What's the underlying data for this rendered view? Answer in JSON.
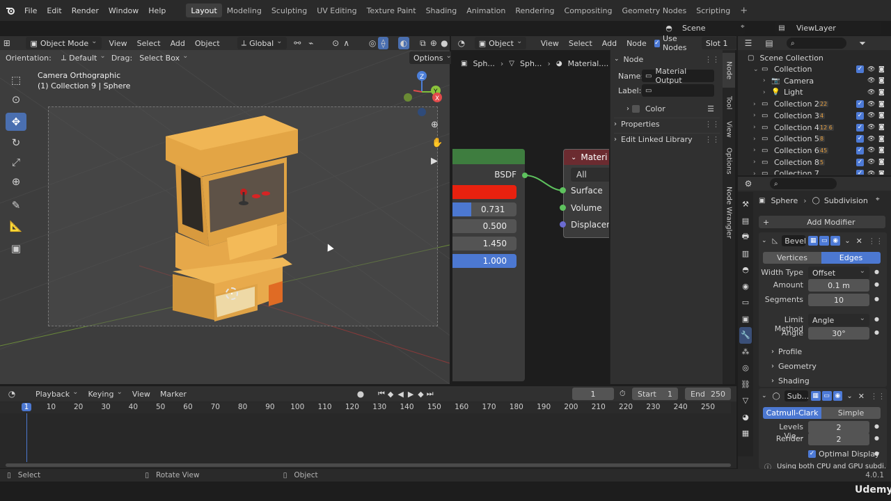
{
  "topbar": {
    "menus": [
      "File",
      "Edit",
      "Render",
      "Window",
      "Help"
    ],
    "workspaces": [
      "Layout",
      "Modeling",
      "Sculpting",
      "UV Editing",
      "Texture Paint",
      "Shading",
      "Animation",
      "Rendering",
      "Compositing",
      "Geometry Nodes",
      "Scripting"
    ],
    "active_workspace": "Layout",
    "plus": "+",
    "scene": "Scene",
    "viewlayer": "ViewLayer"
  },
  "viewport": {
    "mode": "Object Mode",
    "menus": [
      "View",
      "Select",
      "Add",
      "Object"
    ],
    "transform": "Global",
    "orientation_label": "Orientation:",
    "orientation_value": "Default",
    "drag_label": "Drag:",
    "drag_value": "Select Box",
    "options": "Options",
    "overlay_line1": "Camera Orthographic",
    "overlay_line2": "(1) Collection 9 | Sphere"
  },
  "node_editor": {
    "object_menu": "Object",
    "menus": [
      "View",
      "Select",
      "Add",
      "Node"
    ],
    "use_nodes": "Use Nodes",
    "slot": "Slot 1",
    "breadcrumb": [
      "Sph...",
      "Sph...",
      "Material...."
    ],
    "bsdf_label": "BSDF",
    "values": [
      "0.731",
      "0.500",
      "1.450",
      "1.000"
    ],
    "output_title": "Materi",
    "output_target": "All",
    "sockets": [
      "Surface",
      "Volume",
      "Displacen"
    ],
    "colors": {
      "header_green": "#3e7d3f",
      "red": "#e8210f",
      "blue": "#4c78d1",
      "socket_green": "#5ec25e",
      "socket_purple": "#6b6bd1"
    }
  },
  "sidebar": {
    "section": "Node",
    "name_label": "Name:",
    "name_value": "Material Output",
    "label_label": "Label:",
    "color": "Color",
    "properties": "Properties",
    "edit_linked": "Edit Linked Library",
    "tabs": [
      "Node",
      "Tool",
      "View",
      "Options",
      "Node Wrangler"
    ]
  },
  "outliner": {
    "root": "Scene Collection",
    "items": [
      {
        "name": "Collection",
        "level": 1,
        "badge": ""
      },
      {
        "name": "Camera",
        "level": 2,
        "badge": ""
      },
      {
        "name": "Light",
        "level": 2,
        "badge": ""
      },
      {
        "name": "Collection 2",
        "level": 1,
        "badge": "22"
      },
      {
        "name": "Collection 3",
        "level": 1,
        "badge": "4"
      },
      {
        "name": "Collection 4",
        "level": 1,
        "badge": "12 6"
      },
      {
        "name": "Collection 5",
        "level": 1,
        "badge": "8"
      },
      {
        "name": "Collection 6",
        "level": 1,
        "badge": "45"
      },
      {
        "name": "Collection 8",
        "level": 1,
        "badge": "5"
      },
      {
        "name": "Collection 7",
        "level": 1,
        "badge": ""
      }
    ]
  },
  "properties": {
    "object": "Sphere",
    "modifier_context": "Subdivision",
    "add_modifier": "Add Modifier",
    "bevel": {
      "name": "Bevel",
      "tabs": [
        "Vertices",
        "Edges"
      ],
      "active_tab": "Edges",
      "width_type_label": "Width Type",
      "width_type": "Offset",
      "amount_label": "Amount",
      "amount": "0.1 m",
      "segments_label": "Segments",
      "segments": "10",
      "limit_label": "Limit Method",
      "limit": "Angle",
      "angle_label": "Angle",
      "angle": "30°",
      "sections": [
        "Profile",
        "Geometry",
        "Shading"
      ]
    },
    "subdiv": {
      "name": "Sub...",
      "tabs": [
        "Catmull-Clark",
        "Simple"
      ],
      "active_tab": "Catmull-Clark",
      "levels_label": "Levels Vie...",
      "levels": "2",
      "render_label": "Render",
      "render": "2",
      "optimal": "Optimal Display",
      "note": "Using both CPU and GPU subdi..."
    }
  },
  "timeline": {
    "menus": [
      "Playback",
      "Keying",
      "View",
      "Marker"
    ],
    "current_frame": "1",
    "start_label": "Start",
    "start": "1",
    "end_label": "End",
    "end": "250",
    "ticks": [
      "1",
      "10",
      "20",
      "30",
      "40",
      "50",
      "60",
      "70",
      "80",
      "90",
      "100",
      "110",
      "120",
      "130",
      "140",
      "150",
      "160",
      "170",
      "180",
      "190",
      "200",
      "210",
      "220",
      "230",
      "240",
      "250"
    ]
  },
  "statusbar": {
    "select": "Select",
    "rotate": "Rotate View",
    "object": "Object",
    "version": "4.0.1",
    "watermark": "Udemy"
  }
}
